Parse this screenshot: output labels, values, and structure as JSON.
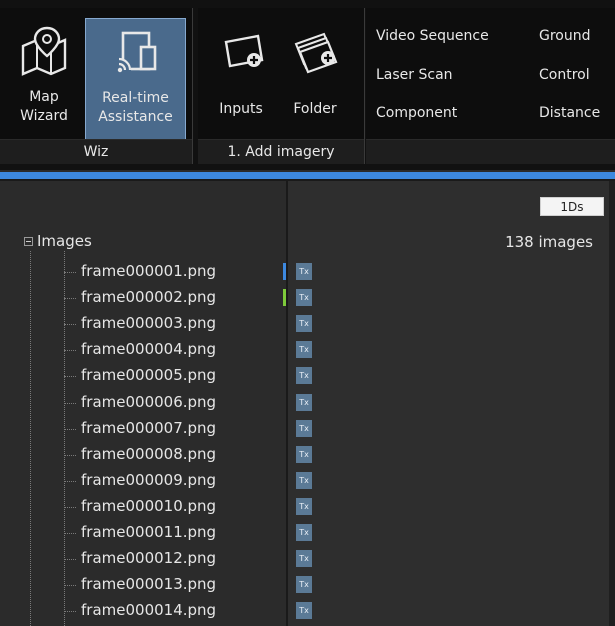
{
  "ribbon": {
    "wiz_group": {
      "label": "Wiz",
      "map_wizard": {
        "line1": "Map",
        "line2": "Wizard"
      },
      "realtime": {
        "line1": "Real-time",
        "line2": "Assistance"
      }
    },
    "imagery_group": {
      "label": "1. Add imagery",
      "inputs": "Inputs",
      "folder": "Folder"
    },
    "other_group": {
      "items": [
        "Video Sequence",
        "Laser Scan",
        "Component",
        "Ground",
        "Control",
        "Distance"
      ]
    }
  },
  "tree": {
    "root_label": "Images",
    "items": [
      "frame000001.png",
      "frame000002.png",
      "frame000003.png",
      "frame000004.png",
      "frame000005.png",
      "frame000006.png",
      "frame000007.png",
      "frame000008.png",
      "frame000009.png",
      "frame000010.png",
      "frame000011.png",
      "frame000012.png",
      "frame000013.png",
      "frame000014.png"
    ],
    "markers": {
      "0": "#3d89e0",
      "1": "#7ecb3b"
    }
  },
  "detail": {
    "column_header": "1Ds",
    "count": "138 images",
    "tag": "Tx"
  }
}
